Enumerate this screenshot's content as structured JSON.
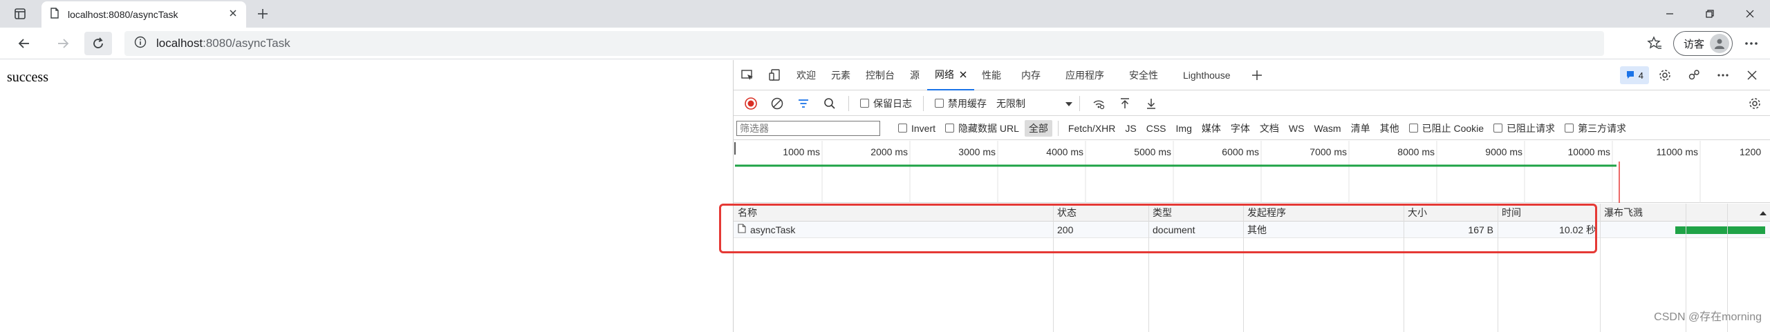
{
  "browser": {
    "tab": {
      "title": "localhost:8080/asyncTask"
    },
    "address": {
      "host": "localhost",
      "path": ":8080/asyncTask"
    },
    "guest_label": "访客"
  },
  "page": {
    "text": "success"
  },
  "devtools": {
    "tabs": [
      {
        "label": "欢迎"
      },
      {
        "label": "元素"
      },
      {
        "label": "控制台"
      },
      {
        "label": "源"
      },
      {
        "label": "网络"
      },
      {
        "label": "性能"
      },
      {
        "label": "内存"
      },
      {
        "label": "应用程序"
      },
      {
        "label": "安全性"
      },
      {
        "label": "Lighthouse"
      }
    ],
    "active_tab": "网络",
    "issues_count": "4",
    "toolbar": {
      "preserve_log": "保留日志",
      "disable_cache": "禁用缓存",
      "throttling": "无限制"
    },
    "filter": {
      "placeholder": "筛选器",
      "invert": "Invert",
      "hide_data_urls": "隐藏数据 URL",
      "types": [
        "全部",
        "Fetch/XHR",
        "JS",
        "CSS",
        "Img",
        "媒体",
        "字体",
        "文档",
        "WS",
        "Wasm",
        "清单",
        "其他"
      ],
      "active_type": "全部",
      "blocked_cookies": "已阻止 Cookie",
      "blocked_requests": "已阻止请求",
      "third_party": "第三方请求"
    },
    "overview": {
      "ticks": [
        "1000 ms",
        "2000 ms",
        "3000 ms",
        "4000 ms",
        "5000 ms",
        "6000 ms",
        "7000 ms",
        "8000 ms",
        "9000 ms",
        "10000 ms",
        "11000 ms",
        "1200"
      ]
    },
    "table": {
      "headers": {
        "name": "名称",
        "status": "状态",
        "type": "类型",
        "initiator": "发起程序",
        "size": "大小",
        "time": "时间",
        "waterfall": "瀑布飞溅"
      },
      "rows": [
        {
          "name": "asyncTask",
          "status": "200",
          "type": "document",
          "initiator": "其他",
          "size": "167 B",
          "time": "10.02 秒"
        }
      ]
    }
  },
  "watermark": "CSDN @存在morning",
  "colors": {
    "accent": "#1a73e8",
    "highlight": "#e53935",
    "waterfall": "#1fa347",
    "record": "#d93025"
  }
}
